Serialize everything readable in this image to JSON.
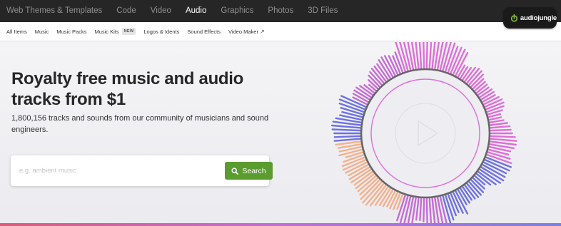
{
  "top_nav": {
    "categories": [
      {
        "label": "Web Themes & Templates"
      },
      {
        "label": "Code"
      },
      {
        "label": "Video"
      },
      {
        "label": "Audio"
      },
      {
        "label": "Graphics"
      },
      {
        "label": "Photos"
      },
      {
        "label": "3D Files"
      }
    ],
    "active_category": "Audio",
    "logo_text": "audiojungle"
  },
  "sub_nav": {
    "items": [
      {
        "label": "All Items"
      },
      {
        "label": "Music"
      },
      {
        "label": "Music Packs"
      },
      {
        "label": "Music Kits",
        "badge": "NEW"
      },
      {
        "label": "Logos & Idents"
      },
      {
        "label": "Sound Effects"
      },
      {
        "label": "Video Maker",
        "icon": "external-link-icon"
      }
    ]
  },
  "hero": {
    "title": "Royalty free music and audio tracks from $1",
    "description": "1,800,156 tracks and sounds from our community of musicians and sound engineers.",
    "search": {
      "placeholder": "e.g. ambient music",
      "value": "",
      "button_label": "Search",
      "button_icon": "search-icon"
    },
    "visual_icon": "play-icon"
  },
  "colors": {
    "nav_bg": "#262626",
    "nav_text": "#8f8f8f",
    "nav_active": "#ffffff",
    "accent_green": "#5b9c2f",
    "logo_green": "#82b541",
    "pink": "#dd6fd8",
    "purple": "#c56cd6",
    "blue": "#6e72e0",
    "peach": "#f4b08c",
    "ring": "#666666"
  }
}
